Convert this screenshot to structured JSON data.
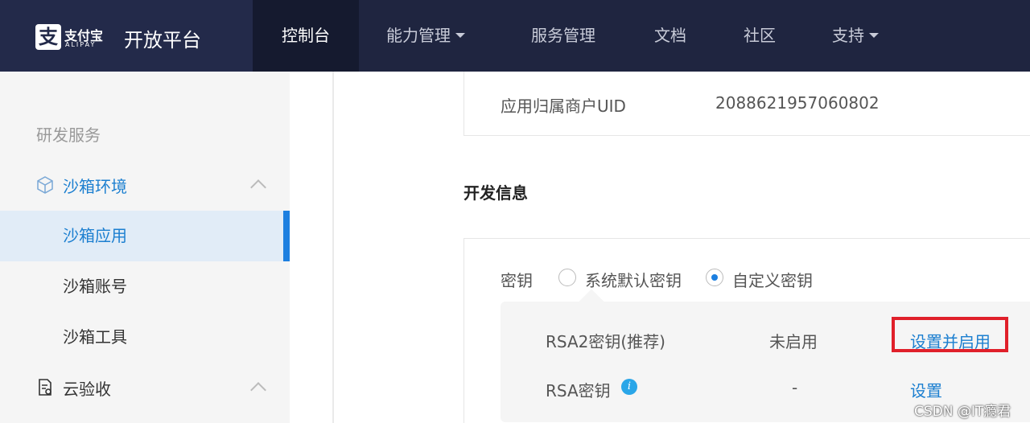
{
  "header": {
    "logo_mark": "支",
    "logo_cn": "支付宝",
    "logo_en": "ALIPAY",
    "platform": "开放平台",
    "nav": [
      {
        "label": "控制台"
      },
      {
        "label": "能力管理"
      },
      {
        "label": "服务管理"
      },
      {
        "label": "文档"
      },
      {
        "label": "社区"
      },
      {
        "label": "支持"
      }
    ]
  },
  "sidebar": {
    "title": "研发服务",
    "group1": {
      "label": "沙箱环境"
    },
    "items": [
      {
        "label": "沙箱应用"
      },
      {
        "label": "沙箱账号"
      },
      {
        "label": "沙箱工具"
      }
    ],
    "group2": {
      "label": "云验收"
    }
  },
  "main": {
    "uid_label": "应用归属商户UID",
    "uid_value": "2088621957060802",
    "dev_title": "开发信息",
    "key_label": "密钥",
    "radio_default": "系统默认密钥",
    "radio_custom": "自定义密钥",
    "rows": [
      {
        "name": "RSA2密钥(推荐)",
        "status": "未启用",
        "action": "设置并启用"
      },
      {
        "name": "RSA密钥",
        "status": "-",
        "action": "设置"
      }
    ],
    "info_glyph": "i"
  },
  "watermark": "CSDN @IT瘾君",
  "colors": {
    "nav_bg": "#1f2540",
    "accent": "#1c7fe0",
    "highlight": "#e0202a"
  }
}
